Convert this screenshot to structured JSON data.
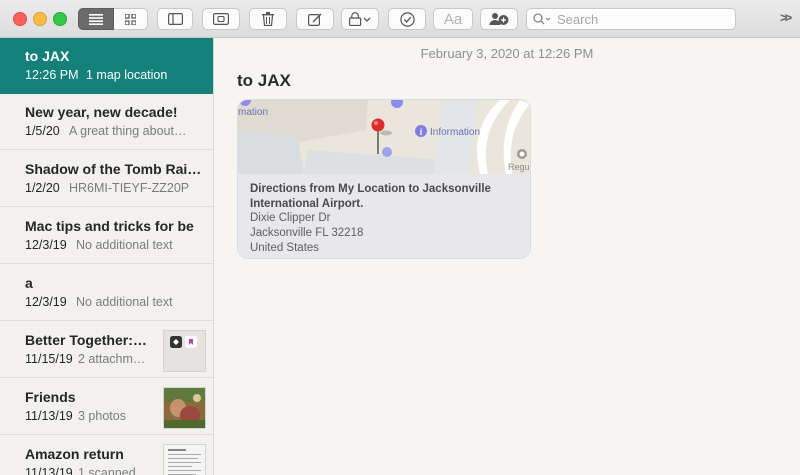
{
  "toolbar": {
    "search_placeholder": "Search",
    "format_label": "Aa",
    "more_label": ">>"
  },
  "notes": [
    {
      "title": "to JAX",
      "date": "12:26 PM",
      "preview": "1 map location",
      "selected": true
    },
    {
      "title": "New year, new decade!",
      "date": "1/5/20",
      "preview": "A great thing about…"
    },
    {
      "title": "Shadow of the Tomb Rai…",
      "date": "1/2/20",
      "preview": "HR6MI-TIEYF-ZZ20P"
    },
    {
      "title": "Mac tips and tricks for be",
      "date": "12/3/19",
      "preview": "No additional text"
    },
    {
      "title": "a",
      "date": "12/3/19",
      "preview": "No additional text"
    },
    {
      "title": "Better Together:…",
      "date": "11/15/19",
      "preview": "2 attachm…"
    },
    {
      "title": "Friends",
      "date": "11/13/19",
      "preview": "3 photos"
    },
    {
      "title": "Amazon return",
      "date": "11/13/19",
      "preview": "1 scanned…"
    }
  ],
  "main": {
    "timestamp": "February 3, 2020 at 12:26 PM",
    "title": "to JAX",
    "map": {
      "labels": {
        "left": "mation",
        "info": "Information",
        "right": "Regu"
      },
      "directions": "Directions from My Location to Jacksonville International Airport.",
      "address_line1": "Dixie Clipper Dr",
      "address_line2": "Jacksonville FL 32218",
      "country": "United States"
    }
  },
  "colors": {
    "selection": "#13817a",
    "pin": "#e22a2a",
    "map_poi": "#7e7fe6"
  }
}
